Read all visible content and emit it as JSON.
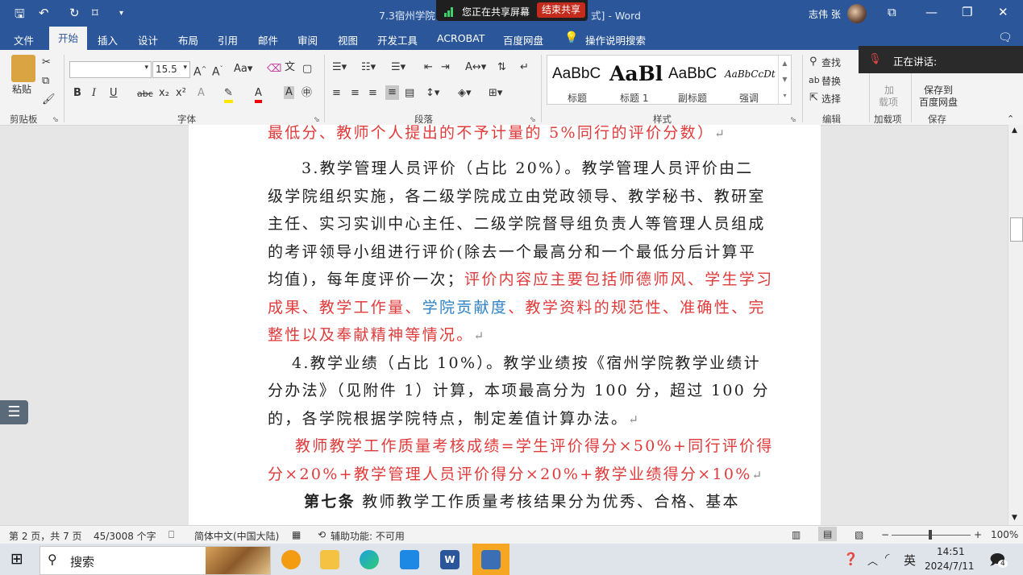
{
  "window": {
    "doc_title": "7.3宿州学院",
    "title_suffix": "式] - Word",
    "user": "志伟 张"
  },
  "sharing": {
    "status": "您正在共享屏幕",
    "stop": "结束共享"
  },
  "tabs": [
    "文件",
    "开始",
    "插入",
    "设计",
    "布局",
    "引用",
    "邮件",
    "审阅",
    "视图",
    "开发工具",
    "ACROBAT",
    "百度网盘"
  ],
  "active_tab": "开始",
  "tell_me": "操作说明搜索",
  "ribbon": {
    "clipboard": {
      "paste": "粘贴",
      "label": "剪贴板"
    },
    "font": {
      "name": "",
      "size": "15.5",
      "aa": "Aa",
      "label": "字体"
    },
    "paragraph": {
      "label": "段落"
    },
    "styles": {
      "label": "样式",
      "items": [
        {
          "sample": "AaBbC",
          "name": "标题"
        },
        {
          "sample": "AaBl",
          "name": "标题 1"
        },
        {
          "sample": "AaBbC",
          "name": "副标题"
        },
        {
          "sample": "AaBbCcDt",
          "name": "强调"
        }
      ]
    },
    "editing": {
      "find": "查找",
      "replace": "替换",
      "select": "选择",
      "label": "编辑"
    },
    "addins": {
      "line1": "加",
      "line2": "载项",
      "label": "加载项"
    },
    "save": {
      "line1": "保存到",
      "line2": "百度网盘",
      "label": "保存"
    }
  },
  "speaking": "正在讲话:",
  "document": {
    "line0": "最低分、教师个人提出的不予计量的 5%同行的评价分数）",
    "line1": "3.教学管理人员评价（占比 20%）。教学管理人员评价由二",
    "line2": "级学院组织实施，各二级学院成立由党政领导、教学秘书、教研室",
    "line3": "主任、实习实训中心主任、二级学院督导组负责人等管理人员组成",
    "line4": "的考评领导小组进行评价(除去一个最高分和一个最低分后计算平",
    "line5a": "均值)，每年度评价一次；",
    "line5b": "评价内容应主要包括师德师风、学生学习",
    "line6a": "成果、教学工作量、",
    "line6b": "学院贡献度",
    "line6c": "、教学资料的规范性、准确性、完",
    "line7": "整性以及奉献精神等情况。",
    "line8": "4.教学业绩（占比 10%）。教学业绩按《宿州学院教学业绩计",
    "line9": "分办法》（见附件 1）计算，本项最高分为 100 分，超过 100 分",
    "line10": "的，各学院根据学院特点，制定差值计算办法。",
    "line11": "教师教学工作质量考核成绩=学生评价得分×50%+同行评价得",
    "line12": "分×20%+教学管理人员评价得分×20%+教学业绩得分×10%",
    "line13a": "第七条",
    "line13b": "教师教学工作质量考核结果分为优秀、合格、基本"
  },
  "status": {
    "page": "第 2 页，共 7 页",
    "words": "45/3008 个字",
    "lang": "简体中文(中国大陆)",
    "accessibility": "辅助功能: 不可用",
    "zoom": "100%"
  },
  "taskbar": {
    "search": "搜索",
    "ime": "英",
    "time": "14:51",
    "date": "2024/7/11",
    "notifications": "4"
  }
}
